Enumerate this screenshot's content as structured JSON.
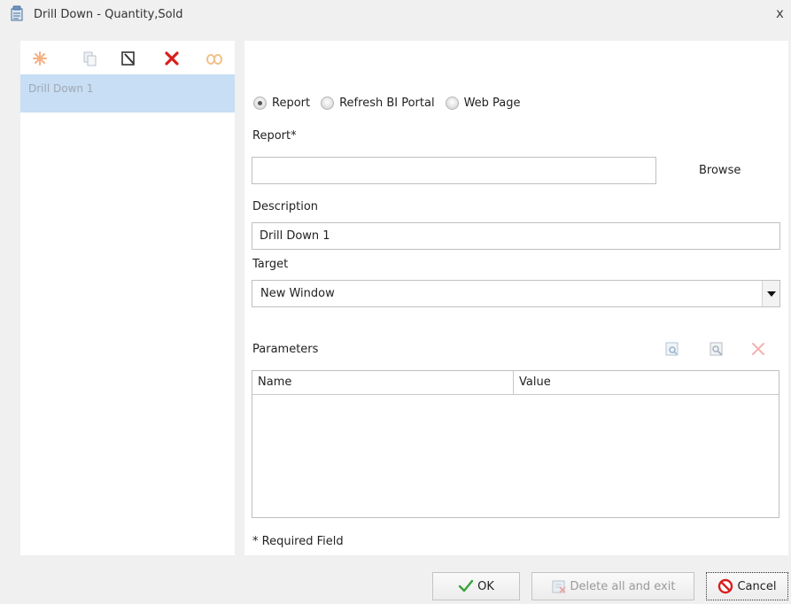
{
  "window": {
    "title": "Drill Down - Quantity,Sold",
    "close_label": "x"
  },
  "left": {
    "toolbar": [
      {
        "name": "new-icon"
      },
      {
        "name": "copy-icon"
      },
      {
        "name": "edit-icon"
      },
      {
        "name": "delete-icon"
      },
      {
        "name": "link-icon"
      }
    ],
    "items": [
      {
        "label": "Drill Down 1",
        "selected": true
      }
    ]
  },
  "form": {
    "target_type": {
      "options": [
        "Report",
        "Refresh BI Portal",
        "Web Page"
      ],
      "selected": "Report"
    },
    "report": {
      "label": "Report*",
      "value": "",
      "browse_label": "Browse"
    },
    "description": {
      "label": "Description",
      "value": "Drill Down 1"
    },
    "target": {
      "label": "Target",
      "value": "New Window"
    },
    "parameters": {
      "label": "Parameters",
      "columns": [
        "Name",
        "Value"
      ],
      "rows": []
    },
    "required_note": "* Required Field"
  },
  "buttons": {
    "ok": "OK",
    "delete_all": "Delete all and exit",
    "cancel": "Cancel"
  },
  "colors": {
    "selected_row": "#c7def4",
    "delete_red": "#d81e1e",
    "ok_green": "#3aa33a"
  }
}
